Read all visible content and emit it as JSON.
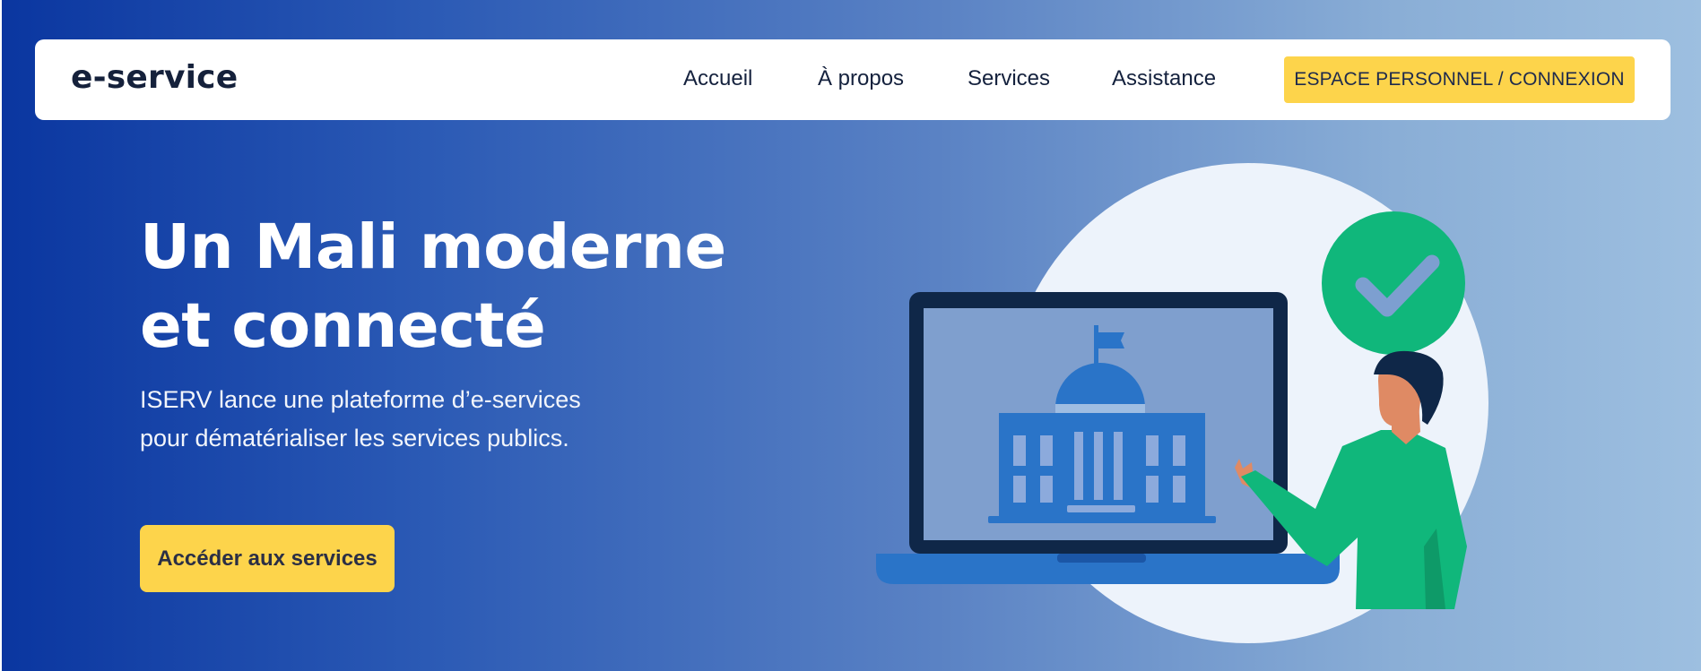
{
  "header": {
    "brand": "e-service",
    "nav": {
      "home": "Accueil",
      "about": "À propos",
      "services": "Services",
      "assistance": "Assistance"
    },
    "login_button": "ESPACE PERSONNEL / CONNEXION"
  },
  "hero": {
    "title_line1": "Un Mali moderne",
    "title_line2": "et connecté",
    "description": "ISERV lance une plateforme d’e-services pour dématérialiser les services publics.",
    "cta_label": "Accéder aux services"
  },
  "colors": {
    "gradient_start": "#0a36a0",
    "gradient_end": "#9dbfe0",
    "accent_yellow": "#fdd44b",
    "success_green": "#10b77b",
    "laptop_blue": "#2a74c8",
    "laptop_frame": "#0f2748"
  },
  "illustration": {
    "icons": [
      "laptop-icon",
      "government-building-icon",
      "checkmark-badge-icon",
      "person-illustration"
    ]
  }
}
